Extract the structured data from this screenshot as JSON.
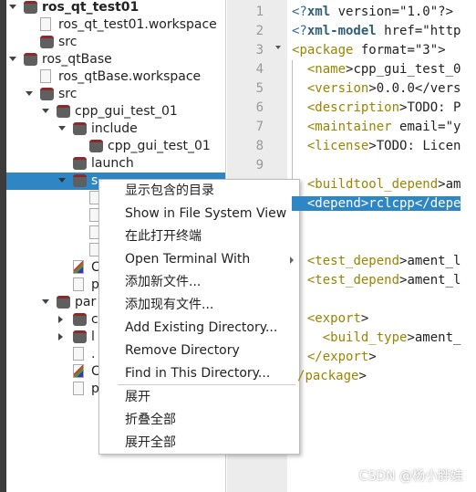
{
  "tree": [
    {
      "label": "ros_qt_test01",
      "icon": "folder",
      "depth": 0,
      "expanded": true,
      "bold": true
    },
    {
      "label": "ros_qt_test01.workspace",
      "icon": "file",
      "depth": 1
    },
    {
      "label": "src",
      "icon": "folder",
      "depth": 1
    },
    {
      "label": "ros_qtBase",
      "icon": "folder",
      "depth": 0,
      "expanded": true
    },
    {
      "label": "ros_qtBase.workspace",
      "icon": "file",
      "depth": 1
    },
    {
      "label": "src",
      "icon": "folder",
      "depth": 1,
      "expanded": true
    },
    {
      "label": "cpp_gui_test_01",
      "icon": "folder",
      "depth": 2,
      "expanded": true
    },
    {
      "label": "include",
      "icon": "folder",
      "depth": 3,
      "expanded": true
    },
    {
      "label": "cpp_gui_test_01",
      "icon": "folder",
      "depth": 4
    },
    {
      "label": "launch",
      "icon": "folder",
      "depth": 3
    },
    {
      "label": "s",
      "icon": "folder",
      "depth": 3,
      "expanded": true,
      "selected": true
    },
    {
      "label": "",
      "icon": "file",
      "depth": 4
    },
    {
      "label": "",
      "icon": "file",
      "depth": 4
    },
    {
      "label": "",
      "icon": "file",
      "depth": 4
    },
    {
      "label": "",
      "icon": "file",
      "depth": 4
    },
    {
      "label": "C",
      "icon": "cmake",
      "depth": 3
    },
    {
      "label": "p",
      "icon": "file",
      "depth": 3
    },
    {
      "label": "par",
      "icon": "folder",
      "depth": 2,
      "expanded": true
    },
    {
      "label": "c",
      "icon": "folder",
      "depth": 3,
      "collapsed": true
    },
    {
      "label": "l",
      "icon": "folder",
      "depth": 3,
      "collapsed": true
    },
    {
      "label": ".",
      "icon": "file",
      "depth": 3
    },
    {
      "label": "C",
      "icon": "cmake",
      "depth": 3
    },
    {
      "label": "p",
      "icon": "file",
      "depth": 3
    }
  ],
  "editor": {
    "line_numbers": [
      "1",
      "2",
      "3",
      "4",
      "5",
      "6",
      "7",
      "8",
      "9"
    ],
    "lines": [
      [
        "<?",
        "xml",
        " version=\"1.0\"?>"
      ],
      [
        "<?",
        "xml-model",
        " href=\"http"
      ],
      [
        "<",
        "package",
        " format=\"3\">"
      ],
      [
        "  <",
        "name",
        ">cpp_gui_test_0"
      ],
      [
        "  <",
        "version",
        ">0.0.0</vers"
      ],
      [
        "  <",
        "description",
        ">TODO: P"
      ],
      [
        "  <",
        "maintainer",
        " email=\"y"
      ],
      [
        "  <",
        "license",
        ">TODO: Licen"
      ],
      [
        "",
        "",
        ""
      ],
      [
        "  <",
        "buildtool_depend",
        ">am"
      ],
      [
        "  <depend>rclcpp</depe",
        "",
        ""
      ],
      [
        "",
        "",
        ""
      ],
      [
        "",
        "",
        ""
      ],
      [
        "  <",
        "test_depend",
        ">ament_l"
      ],
      [
        "  <",
        "test_depend",
        ">ament_l"
      ],
      [
        "",
        "",
        ""
      ],
      [
        "  <",
        "export",
        ">"
      ],
      [
        "    <",
        "build_type",
        ">ament_"
      ],
      [
        "  </",
        "export",
        ">"
      ],
      [
        "/",
        "package",
        ">"
      ]
    ]
  },
  "context_menu": {
    "items": [
      {
        "label": "显示包含的目录"
      },
      {
        "label": "Show in File System View"
      },
      {
        "label": "在此打开终端"
      },
      {
        "label": "Open Terminal With",
        "submenu": true
      },
      {
        "label": "添加新文件..."
      },
      {
        "label": "添加现有文件..."
      },
      {
        "label": "Add Existing Directory..."
      },
      {
        "label": "Remove Directory"
      },
      {
        "label": "Find in This Directory..."
      },
      {
        "label": "展开"
      },
      {
        "label": "折叠全部"
      },
      {
        "label": "展开全部"
      }
    ]
  },
  "watermark": "CSDN @杨小胖娃"
}
